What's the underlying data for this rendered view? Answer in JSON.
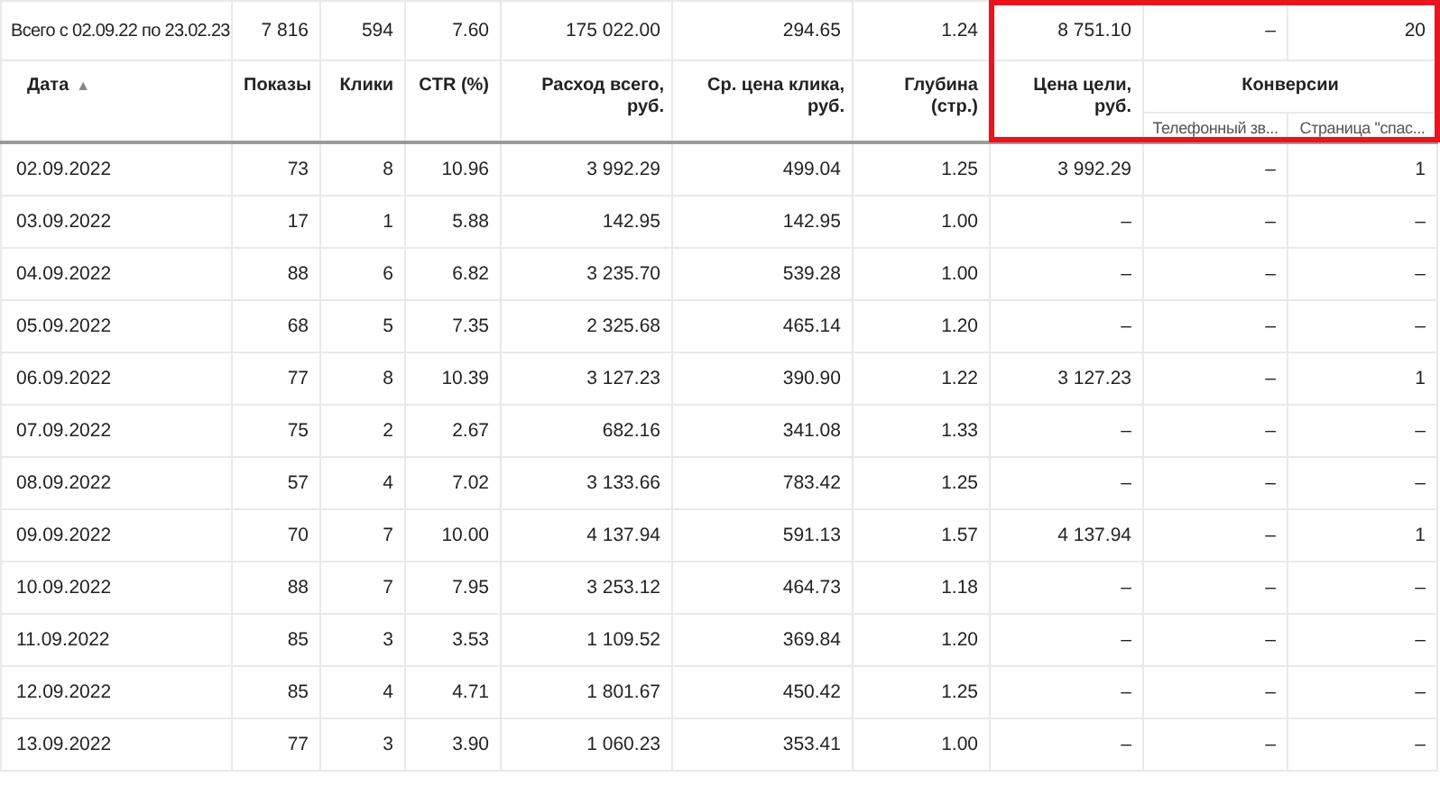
{
  "totals": {
    "label": "Всего с 02.09.22 по 23.02.23",
    "values": [
      "7 816",
      "594",
      "7.60",
      "175 022.00",
      "294.65",
      "1.24",
      "8 751.10",
      "–",
      "20"
    ]
  },
  "columns": [
    {
      "label": "Дата",
      "sort": "▲"
    },
    {
      "label": "Показы"
    },
    {
      "label": "Клики"
    },
    {
      "label": "CTR (%)"
    },
    {
      "label": "Расход всего, руб."
    },
    {
      "label": "Ср. цена клика, руб."
    },
    {
      "label": "Глубина (стр.)"
    },
    {
      "label": "Цена цели, руб."
    }
  ],
  "column_group": {
    "label": "Конверсии",
    "subcolumns": [
      "Телефонный зв...",
      "Страница \"спас..."
    ]
  },
  "rows": [
    {
      "cells": [
        "02.09.2022",
        "73",
        "8",
        "10.96",
        "3 992.29",
        "499.04",
        "1.25",
        "3 992.29",
        "–",
        "1"
      ]
    },
    {
      "cells": [
        "03.09.2022",
        "17",
        "1",
        "5.88",
        "142.95",
        "142.95",
        "1.00",
        "–",
        "–",
        "–"
      ]
    },
    {
      "cells": [
        "04.09.2022",
        "88",
        "6",
        "6.82",
        "3 235.70",
        "539.28",
        "1.00",
        "–",
        "–",
        "–"
      ]
    },
    {
      "cells": [
        "05.09.2022",
        "68",
        "5",
        "7.35",
        "2 325.68",
        "465.14",
        "1.20",
        "–",
        "–",
        "–"
      ]
    },
    {
      "cells": [
        "06.09.2022",
        "77",
        "8",
        "10.39",
        "3 127.23",
        "390.90",
        "1.22",
        "3 127.23",
        "–",
        "1"
      ]
    },
    {
      "cells": [
        "07.09.2022",
        "75",
        "2",
        "2.67",
        "682.16",
        "341.08",
        "1.33",
        "–",
        "–",
        "–"
      ]
    },
    {
      "cells": [
        "08.09.2022",
        "57",
        "4",
        "7.02",
        "3 133.66",
        "783.42",
        "1.25",
        "–",
        "–",
        "–"
      ]
    },
    {
      "cells": [
        "09.09.2022",
        "70",
        "7",
        "10.00",
        "4 137.94",
        "591.13",
        "1.57",
        "4 137.94",
        "–",
        "1"
      ]
    },
    {
      "cells": [
        "10.09.2022",
        "88",
        "7",
        "7.95",
        "3 253.12",
        "464.73",
        "1.18",
        "–",
        "–",
        "–"
      ]
    },
    {
      "cells": [
        "11.09.2022",
        "85",
        "3",
        "3.53",
        "1 109.52",
        "369.84",
        "1.20",
        "–",
        "–",
        "–"
      ]
    },
    {
      "cells": [
        "12.09.2022",
        "85",
        "4",
        "4.71",
        "1 801.67",
        "450.42",
        "1.25",
        "–",
        "–",
        "–"
      ]
    },
    {
      "cells": [
        "13.09.2022",
        "77",
        "3",
        "3.90",
        "1 060.23",
        "353.41",
        "1.00",
        "–",
        "–",
        "–"
      ]
    }
  ]
}
